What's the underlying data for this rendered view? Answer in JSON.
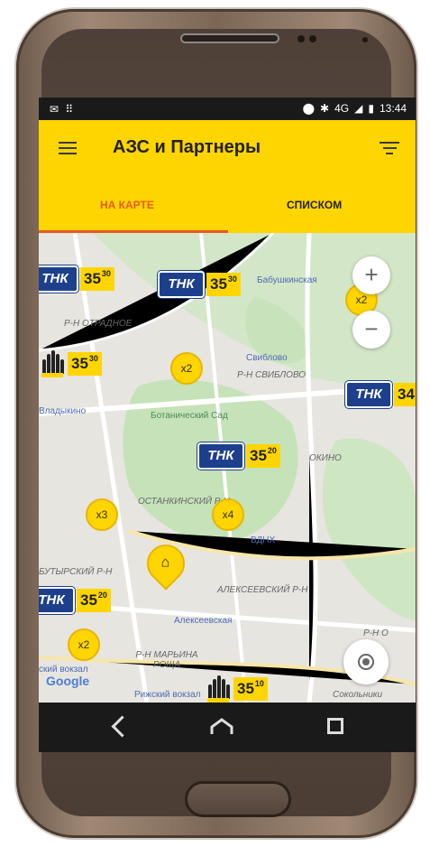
{
  "statusbar": {
    "left_icons": "✉ ⠿",
    "network": "4G",
    "time": "13:44"
  },
  "appbar": {
    "title": "АЗС и Партнеры"
  },
  "tabs": [
    {
      "label": "НА КАРТЕ"
    },
    {
      "label": "СПИСКОМ"
    }
  ],
  "map": {
    "labels": {
      "babushkinskaya": "Бабушкинская",
      "otradnoe": "Р-Н ОТРАДНОЕ",
      "sviblovo_station": "Свиблово",
      "sviblovo_district": "Р-Н СВИБЛОВО",
      "vladykino": "Владыкино",
      "botanic_garden": "Ботанический Сад",
      "ostankino": "ОСТАНКИНСКИЙ Р-Н",
      "vdnh": "ВДНХ",
      "butyrsky": "БУТЫРСКИЙ Р-Н",
      "alekseevsky_district": "АЛЕКСЕЕВСКИЙ Р-Н",
      "alekseevskaya": "Алексеевская",
      "maryina_roshcha": "Р-Н МАРЬИНА РОЩА",
      "rizhsky_vokzal": "Рижский вокзал",
      "sokolniki": "Сокольники",
      "rostokino": "ОКИНО",
      "vokzal": "ский вокзал",
      "rp_partial": "Р-Н О"
    },
    "stations": [
      {
        "brand": "ТНК",
        "price_main": "35",
        "price_small": "30"
      },
      {
        "brand": "ТНК",
        "price_main": "35",
        "price_small": "30"
      },
      {
        "brand": "Роснефть",
        "price_main": "35",
        "price_small": "30"
      },
      {
        "brand": "ТНК",
        "price_main": "34",
        "price_small": ""
      },
      {
        "brand": "ТНК",
        "price_main": "35",
        "price_small": "20"
      },
      {
        "brand": "ТНК",
        "price_main": "35",
        "price_small": "20"
      },
      {
        "brand": "Роснефть",
        "price_main": "35",
        "price_small": "10"
      }
    ],
    "clusters": [
      "x2",
      "x2",
      "x3",
      "x4",
      "x2"
    ],
    "zoom_in": "+",
    "zoom_out": "−",
    "google": "Google"
  },
  "icons": [
    "menu-icon",
    "filter-icon",
    "zoom-in-icon",
    "zoom-out-icon",
    "home-pin-icon",
    "my-location-icon",
    "back-icon",
    "home-icon",
    "recent-apps-icon"
  ],
  "colors": {
    "accent": "#ffd500",
    "tab_active": "#e85a20",
    "tnk_blue": "#1d3f8c"
  }
}
